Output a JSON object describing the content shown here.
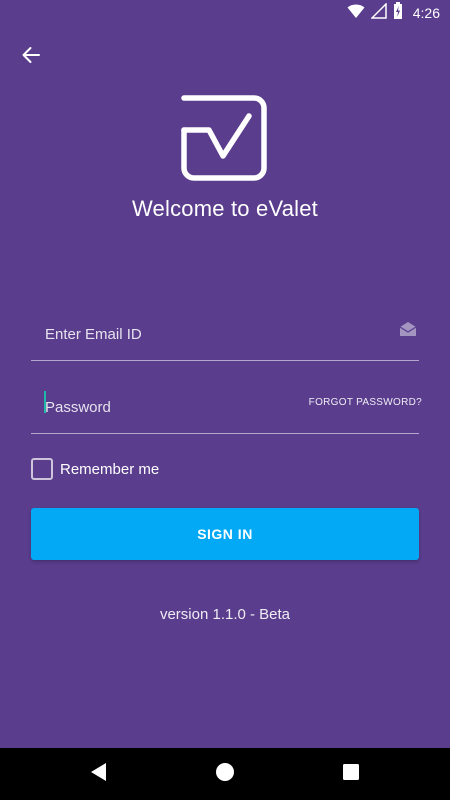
{
  "status_bar": {
    "time": "4:26",
    "icons": [
      "wifi-icon",
      "signal-icon",
      "battery-charging-icon"
    ]
  },
  "header": {
    "back_icon": "arrow-left-icon",
    "logo_icon": "evalet-logo-icon",
    "title": "Welcome to eValet"
  },
  "form": {
    "email": {
      "placeholder": "Enter Email ID",
      "value": "",
      "icon": "envelope-icon"
    },
    "password": {
      "placeholder": "Password",
      "value": "",
      "forgot_label": "FORGOT PASSWORD?"
    },
    "remember": {
      "label": "Remember me",
      "checked": false
    },
    "submit_label": "SIGN IN"
  },
  "footer": {
    "version": "version 1.1.0 - Beta"
  },
  "nav_bar": {
    "buttons": [
      "back-triangle-icon",
      "home-circle-icon",
      "recents-square-icon"
    ]
  },
  "colors": {
    "background": "#5a3d8d",
    "accent_button": "#03a9f4",
    "cursor": "#1fb7a6"
  }
}
